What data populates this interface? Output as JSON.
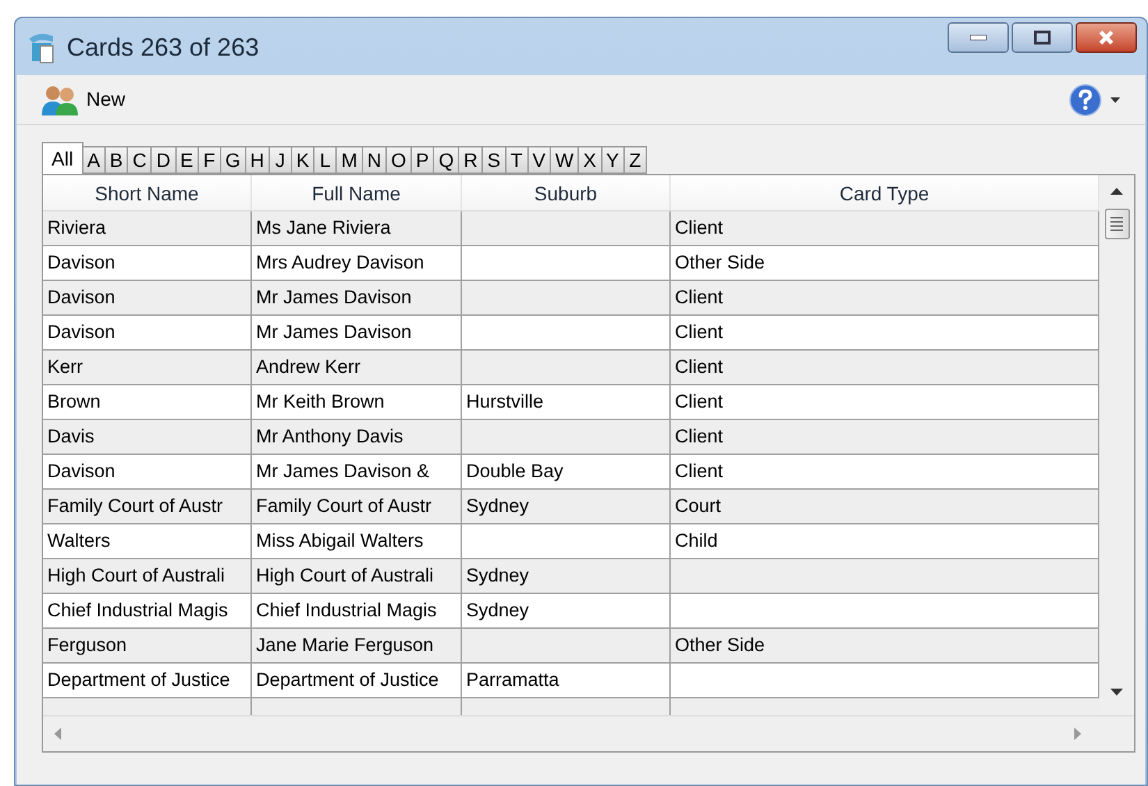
{
  "window": {
    "title": "Cards 263 of 263"
  },
  "toolbar": {
    "new_label": "New"
  },
  "tabs": [
    {
      "label": "All",
      "selected": true
    },
    {
      "label": "A",
      "selected": false
    },
    {
      "label": "B",
      "selected": false
    },
    {
      "label": "C",
      "selected": false
    },
    {
      "label": "D",
      "selected": false
    },
    {
      "label": "E",
      "selected": false
    },
    {
      "label": "F",
      "selected": false
    },
    {
      "label": "G",
      "selected": false
    },
    {
      "label": "H",
      "selected": false
    },
    {
      "label": "J",
      "selected": false
    },
    {
      "label": "K",
      "selected": false
    },
    {
      "label": "L",
      "selected": false
    },
    {
      "label": "M",
      "selected": false
    },
    {
      "label": "N",
      "selected": false
    },
    {
      "label": "O",
      "selected": false
    },
    {
      "label": "P",
      "selected": false
    },
    {
      "label": "Q",
      "selected": false
    },
    {
      "label": "R",
      "selected": false
    },
    {
      "label": "S",
      "selected": false
    },
    {
      "label": "T",
      "selected": false
    },
    {
      "label": "V",
      "selected": false
    },
    {
      "label": "W",
      "selected": false
    },
    {
      "label": "X",
      "selected": false
    },
    {
      "label": "Y",
      "selected": false
    },
    {
      "label": "Z",
      "selected": false
    }
  ],
  "table": {
    "columns": [
      "Short Name",
      "Full Name",
      "Suburb",
      "Card Type"
    ],
    "rows": [
      [
        "Riviera",
        "Ms Jane Riviera",
        "",
        "Client"
      ],
      [
        "Davison",
        "Mrs Audrey Davison",
        "",
        "Other Side"
      ],
      [
        "Davison",
        "Mr James Davison",
        "",
        "Client"
      ],
      [
        "Davison",
        "Mr James Davison",
        "",
        "Client"
      ],
      [
        "Kerr",
        "Andrew Kerr",
        "",
        "Client"
      ],
      [
        "Brown",
        "Mr Keith Brown",
        "Hurstville",
        "Client"
      ],
      [
        "Davis",
        "Mr Anthony Davis",
        "",
        "Client"
      ],
      [
        "Davison",
        "Mr James Davison &",
        "Double Bay",
        "Client"
      ],
      [
        "Family Court of Austr",
        "Family Court of Austr",
        "Sydney",
        "Court"
      ],
      [
        "Walters",
        "Miss Abigail Walters",
        "",
        "Child"
      ],
      [
        "High Court of Australi",
        "High Court of Australi",
        "Sydney",
        ""
      ],
      [
        "Chief Industrial Magis",
        "Chief Industrial Magis",
        "Sydney",
        ""
      ],
      [
        "Ferguson",
        "Jane Marie Ferguson",
        "",
        "Other Side"
      ],
      [
        "Department of Justice",
        "Department of Justice",
        "Parramatta",
        ""
      ]
    ]
  }
}
